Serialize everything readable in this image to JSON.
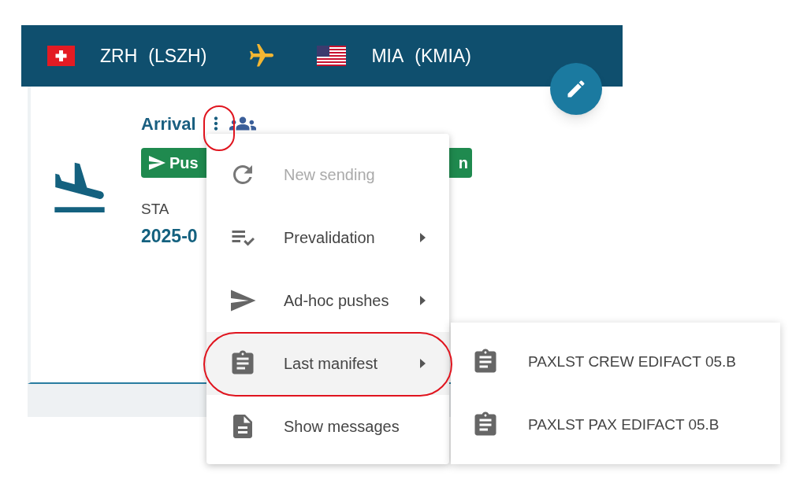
{
  "route": {
    "origin": {
      "code": "ZRH",
      "icao": "(LSZH)"
    },
    "destination": {
      "code": "MIA",
      "icao": "(KMIA)"
    }
  },
  "card": {
    "title": "Arrival",
    "status_buttons": [
      "Pus",
      "n"
    ],
    "time_label": "STA",
    "time_value": "2025-0"
  },
  "menu": {
    "items": [
      {
        "label": "New sending",
        "kind": "refresh",
        "disabled": true,
        "has_submenu": false,
        "selected": false
      },
      {
        "label": "Prevalidation",
        "kind": "checklist",
        "disabled": false,
        "has_submenu": true,
        "selected": false
      },
      {
        "label": "Ad-hoc pushes",
        "kind": "send",
        "disabled": false,
        "has_submenu": true,
        "selected": false
      },
      {
        "label": "Last manifest",
        "kind": "clipboard",
        "disabled": false,
        "has_submenu": true,
        "selected": true
      },
      {
        "label": "Show messages",
        "kind": "document",
        "disabled": false,
        "has_submenu": false,
        "selected": false
      }
    ]
  },
  "submenu": {
    "items": [
      {
        "label": "PAXLST CREW EDIFACT 05.B"
      },
      {
        "label": "PAXLST PAX EDIFACT 05.B"
      }
    ]
  }
}
